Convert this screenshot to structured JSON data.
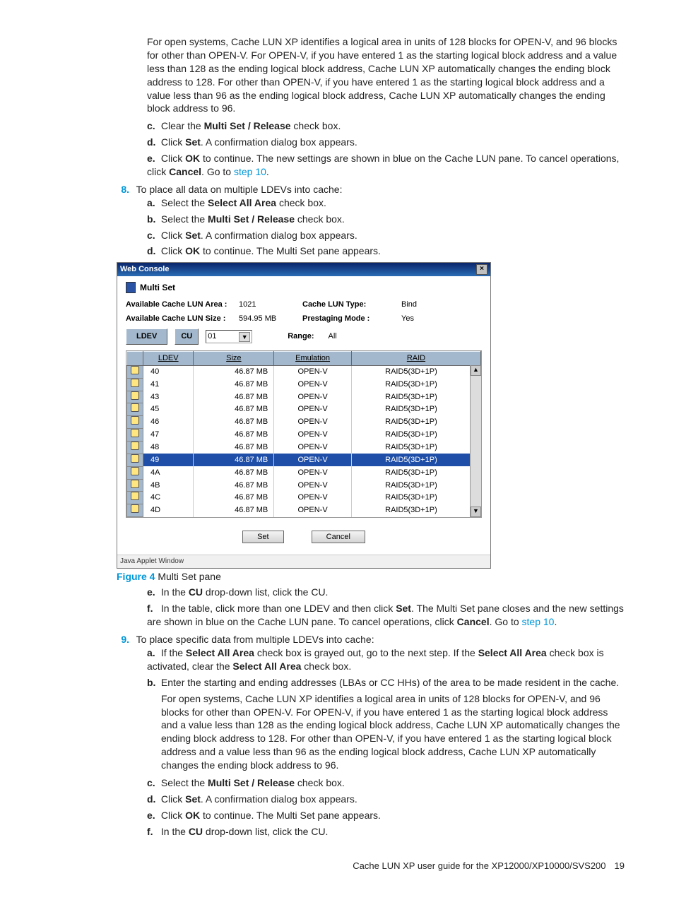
{
  "top_para": "For open systems, Cache LUN XP identifies a logical area in units of 128 blocks for OPEN-V, and 96 blocks for other than OPEN-V. For OPEN-V, if you have entered 1 as the starting logical block address and a value less than 128 as the ending logical block address, Cache LUN XP automatically changes the ending block address to 128. For other than OPEN-V, if you have entered 1 as the starting logical block address and a value less than 96 as the ending logical block address, Cache LUN XP automatically changes the ending block address to 96.",
  "sub_c_1": {
    "marker": "c.",
    "pre": "Clear the ",
    "bold": "Multi Set / Release",
    "post": " check box."
  },
  "sub_d_1": {
    "marker": "d.",
    "pre": "Click ",
    "bold": "Set",
    "post": ". A confirmation dialog box appears."
  },
  "sub_e_1": {
    "marker": "e.",
    "pre": "Click ",
    "bold1": "OK",
    "mid": " to continue. The new settings are shown in blue on the Cache LUN pane. To cancel operations, click ",
    "bold2": "Cancel",
    "post": ". Go to ",
    "link": "step 10",
    "end": "."
  },
  "step8": {
    "num": "8.",
    "text": "To place all data on multiple LDEVs into cache:"
  },
  "s8a": {
    "marker": "a.",
    "pre": "Select the ",
    "bold": "Select All Area",
    "post": " check box."
  },
  "s8b": {
    "marker": "b.",
    "pre": "Select the ",
    "bold": "Multi Set / Release",
    "post": " check box."
  },
  "s8c": {
    "marker": "c.",
    "pre": "Click ",
    "bold": "Set",
    "post": ". A confirmation dialog box appears."
  },
  "s8d": {
    "marker": "d.",
    "pre": "Click ",
    "bold": "OK",
    "post": " to continue. The Multi Set pane appears."
  },
  "win": {
    "title": "Web Console",
    "pane_title": "Multi Set",
    "info": {
      "area_label": "Available Cache LUN Area :",
      "area_val": "1021",
      "size_label": "Available Cache LUN Size :",
      "size_val": "594.95 MB",
      "type_label": "Cache LUN Type:",
      "type_val": "Bind",
      "mode_label": "Prestaging Mode  :",
      "mode_val": "Yes"
    },
    "ldev_btn": "LDEV",
    "cu_btn": "CU",
    "cu_val": "01",
    "range_label": "Range:",
    "range_val": "All",
    "headers": {
      "ldev": "LDEV",
      "size": "Size",
      "emul": "Emulation",
      "raid": "RAID"
    },
    "rows": [
      {
        "ldev": "40",
        "size": "46.87 MB",
        "emul": "OPEN-V",
        "raid": "RAID5(3D+1P)",
        "sel": false
      },
      {
        "ldev": "41",
        "size": "46.87 MB",
        "emul": "OPEN-V",
        "raid": "RAID5(3D+1P)",
        "sel": false
      },
      {
        "ldev": "43",
        "size": "46.87 MB",
        "emul": "OPEN-V",
        "raid": "RAID5(3D+1P)",
        "sel": false
      },
      {
        "ldev": "45",
        "size": "46.87 MB",
        "emul": "OPEN-V",
        "raid": "RAID5(3D+1P)",
        "sel": false
      },
      {
        "ldev": "46",
        "size": "46.87 MB",
        "emul": "OPEN-V",
        "raid": "RAID5(3D+1P)",
        "sel": false
      },
      {
        "ldev": "47",
        "size": "46.87 MB",
        "emul": "OPEN-V",
        "raid": "RAID5(3D+1P)",
        "sel": false
      },
      {
        "ldev": "48",
        "size": "46.87 MB",
        "emul": "OPEN-V",
        "raid": "RAID5(3D+1P)",
        "sel": false
      },
      {
        "ldev": "49",
        "size": "46.87 MB",
        "emul": "OPEN-V",
        "raid": "RAID5(3D+1P)",
        "sel": true
      },
      {
        "ldev": "4A",
        "size": "46.87 MB",
        "emul": "OPEN-V",
        "raid": "RAID5(3D+1P)",
        "sel": false
      },
      {
        "ldev": "4B",
        "size": "46.87 MB",
        "emul": "OPEN-V",
        "raid": "RAID5(3D+1P)",
        "sel": false
      },
      {
        "ldev": "4C",
        "size": "46.87 MB",
        "emul": "OPEN-V",
        "raid": "RAID5(3D+1P)",
        "sel": false
      },
      {
        "ldev": "4D",
        "size": "46.87 MB",
        "emul": "OPEN-V",
        "raid": "RAID5(3D+1P)",
        "sel": false
      }
    ],
    "set_btn": "Set",
    "cancel_btn": "Cancel",
    "status": "Java Applet Window"
  },
  "fig": {
    "label": "Figure 4",
    "caption": " Multi Set pane"
  },
  "s8e": {
    "marker": "e.",
    "pre": "In the ",
    "bold": "CU",
    "post": " drop-down list, click the CU."
  },
  "s8f": {
    "marker": "f.",
    "pre": "In the table, click more than one LDEV and then click ",
    "bold1": "Set",
    "mid": ". The Multi Set pane closes and the new settings are shown in blue on the Cache LUN pane. To cancel operations, click ",
    "bold2": "Cancel",
    "post": ". Go to ",
    "link": "step 10",
    "end": "."
  },
  "step9": {
    "num": "9.",
    "text": "To place specific data from multiple LDEVs into cache:"
  },
  "s9a": {
    "marker": "a.",
    "pre": "If the ",
    "bold1": "Select All Area",
    "mid": " check box is grayed out, go to the next step. If the ",
    "bold2": "Select All Area",
    "mid2": " check box is activated, clear the ",
    "bold3": "Select All Area",
    "post": " check box."
  },
  "s9b": {
    "marker": "b.",
    "text": "Enter the starting and ending addresses (LBAs or CC HHs) of the area to be made resident in the cache."
  },
  "s9para": "For open systems, Cache LUN XP identifies a logical area in units of 128 blocks for OPEN-V, and 96 blocks for other than OPEN-V. For OPEN-V, if you have entered 1 as the starting logical block address and a value less than 128 as the ending logical block address, Cache LUN XP automatically changes the ending block address to 128. For other than OPEN-V, if you have entered 1 as the starting logical block address and a value less than 96 as the ending logical block address, Cache LUN XP automatically changes the ending block address to 96.",
  "s9c": {
    "marker": "c.",
    "pre": "Select the ",
    "bold": "Multi Set / Release",
    "post": " check box."
  },
  "s9d": {
    "marker": "d.",
    "pre": "Click ",
    "bold": "Set",
    "post": ". A confirmation dialog box appears."
  },
  "s9e": {
    "marker": "e.",
    "pre": "Click ",
    "bold": "OK",
    "post": " to continue. The Multi Set pane appears."
  },
  "s9f": {
    "marker": "f.",
    "pre": "In the ",
    "bold": "CU",
    "post": " drop-down list, click the CU."
  },
  "footer": {
    "text": "Cache LUN XP user guide for the XP12000/XP10000/SVS200",
    "page": "19"
  }
}
